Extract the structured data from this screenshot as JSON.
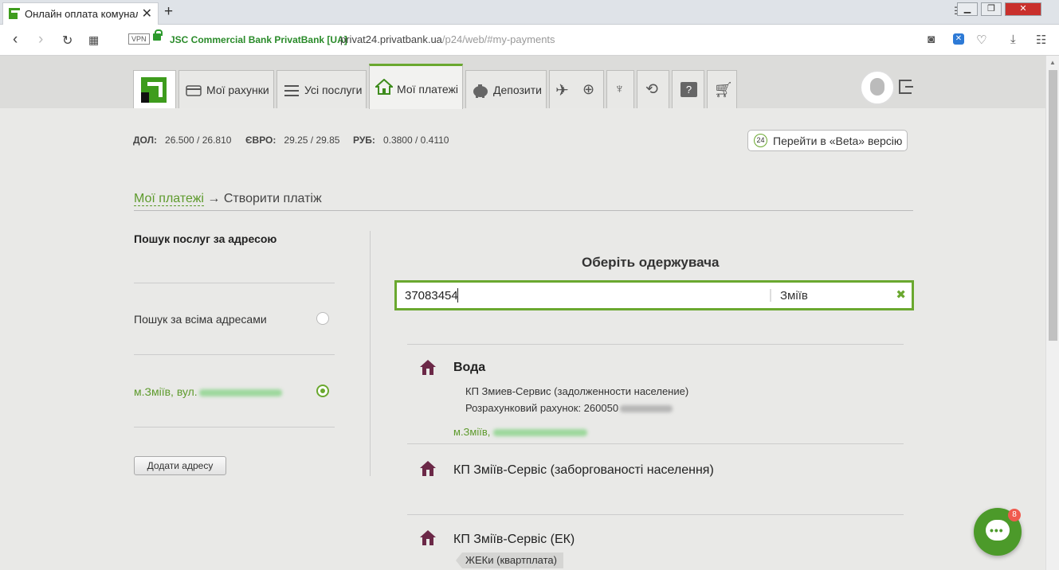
{
  "browser": {
    "tab_title": "Онлайн оплата комунальн",
    "url_host": "privat24.privatbank.ua",
    "url_path": "/p24/web/#my-payments",
    "org_name": "JSC Commercial Bank PrivatBank [UA]",
    "vpn_label": "VPN"
  },
  "nav": {
    "tabs": [
      "Мої рахунки",
      "Усі послуги",
      "Мої платежі",
      "Депозити"
    ],
    "active": "Мої платежі"
  },
  "rates": {
    "usd_label": "ДОЛ:",
    "usd": "26.500 / 26.810",
    "eur_label": "ЄВРО:",
    "eur": "29.25 / 29.85",
    "rub_label": "РУБ:",
    "rub": "0.3800 / 0.4110"
  },
  "beta": {
    "badge": "24",
    "label": "Перейти в «Beta» версію"
  },
  "breadcrumb": {
    "link": "Мої платежі",
    "arrow": "→",
    "current": "Створити платіж"
  },
  "left": {
    "title": "Пошук послуг за адресою",
    "all_addresses": "Пошук за всіма адресами",
    "address": "м.Зміїв, вул.",
    "add_button": "Додати адресу"
  },
  "right": {
    "title": "Оберіть одержувача",
    "search_value": "37083454",
    "city_value": "Зміїв",
    "results": [
      {
        "name": "Вода",
        "org": "КП Змиев-Сервис (задолженности население)",
        "account": "Розрахунковий рахунок: 260050",
        "address": "м.Зміїв,"
      },
      {
        "name": "КП Зміїв-Сервіс (заборгованості населення)"
      },
      {
        "name": "КП Зміїв-Сервіс (ЕК)",
        "tag": "ЖЕКи (квартплата)"
      }
    ]
  },
  "chat": {
    "badge": "8"
  },
  "colors": {
    "accent": "#6aa82f",
    "brand": "#3e9c1d",
    "house": "#6b2847"
  }
}
